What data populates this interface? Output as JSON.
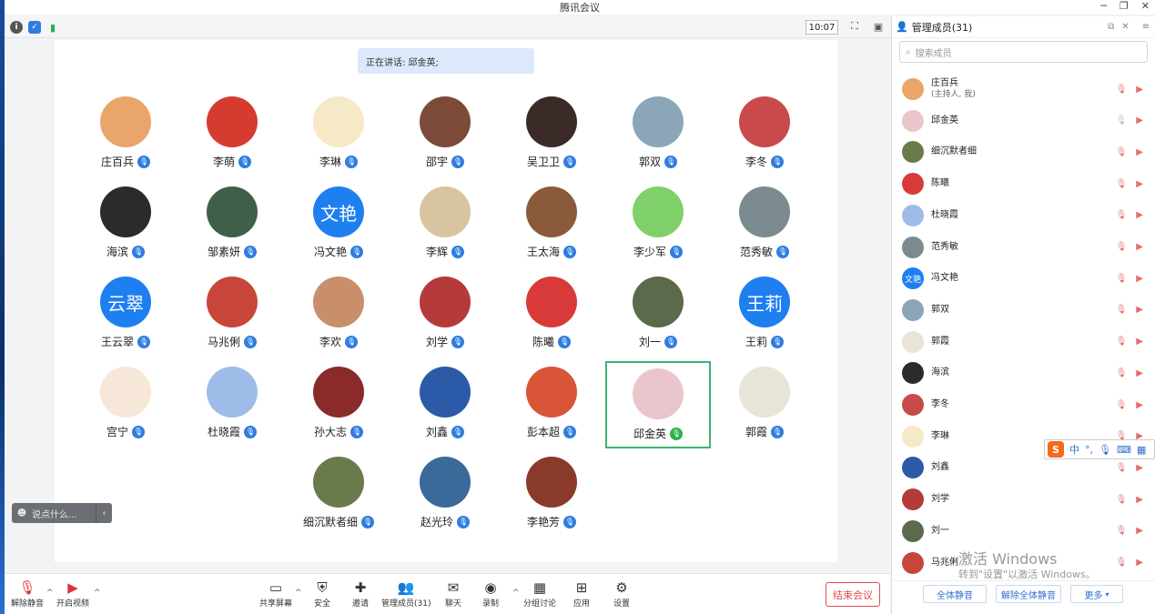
{
  "window": {
    "title": "腾讯会议",
    "time": "10:07"
  },
  "speaker": {
    "label": "正在讲话: 邱金英;"
  },
  "participants": [
    {
      "name": "庄百兵",
      "color": "#e9a56a",
      "kind": "img"
    },
    {
      "name": "李萌",
      "color": "#d63b2f",
      "kind": "img"
    },
    {
      "name": "李琳",
      "color": "#f5e9c8",
      "kind": "img"
    },
    {
      "name": "邵宇",
      "color": "#7d4a3a",
      "kind": "img"
    },
    {
      "name": "吴卫卫",
      "color": "#3a2a28",
      "kind": "img"
    },
    {
      "name": "郭双",
      "color": "#8aa6b8",
      "kind": "img"
    },
    {
      "name": "李冬",
      "color": "#c94a4a",
      "kind": "img"
    },
    {
      "name": "海滨",
      "color": "#2b2b2b",
      "kind": "img"
    },
    {
      "name": "邹素妍",
      "color": "#3f5f4a",
      "kind": "img"
    },
    {
      "name": "冯文艳",
      "color": "#1e7ff0",
      "kind": "text",
      "avatar_text": "文艳"
    },
    {
      "name": "李辉",
      "color": "#d9c4a0",
      "kind": "img"
    },
    {
      "name": "王太海",
      "color": "#8a5a3a",
      "kind": "img"
    },
    {
      "name": "李少军",
      "color": "#7fd06a",
      "kind": "img"
    },
    {
      "name": "范秀敏",
      "color": "#7a8a8f",
      "kind": "img"
    },
    {
      "name": "王云翠",
      "color": "#1e7ff0",
      "kind": "text",
      "avatar_text": "云翠"
    },
    {
      "name": "马兆俐",
      "color": "#c8453a",
      "kind": "img"
    },
    {
      "name": "李欢",
      "color": "#c98f6a",
      "kind": "img"
    },
    {
      "name": "刘学",
      "color": "#b53a3a",
      "kind": "img"
    },
    {
      "name": "陈曦",
      "color": "#d83a3a",
      "kind": "img"
    },
    {
      "name": "刘一",
      "color": "#5a6a4a",
      "kind": "img"
    },
    {
      "name": "王莉",
      "color": "#1e7ff0",
      "kind": "text",
      "avatar_text": "王莉"
    },
    {
      "name": "宫宁",
      "color": "#f6e7d8",
      "kind": "img"
    },
    {
      "name": "杜晓霞",
      "color": "#9fbbe8",
      "kind": "img"
    },
    {
      "name": "孙大志",
      "color": "#8a2a2a",
      "kind": "img"
    },
    {
      "name": "刘鑫",
      "color": "#2b5aa8",
      "kind": "img"
    },
    {
      "name": "彭本超",
      "color": "#d8553a",
      "kind": "img"
    },
    {
      "name": "邱金英",
      "color": "#e9c6cc",
      "kind": "img",
      "active": true
    },
    {
      "name": "郭霞",
      "color": "#e8e4d8",
      "kind": "img"
    },
    {
      "name": "细沉默者细",
      "color": "#6a7a4a",
      "kind": "img"
    },
    {
      "name": "赵光玲",
      "color": "#3a6a9a",
      "kind": "img"
    },
    {
      "name": "李艳芳",
      "color": "#8a3a2a",
      "kind": "img"
    }
  ],
  "chat": {
    "placeholder": "说点什么..."
  },
  "toolbar": {
    "unmute": "解除静音",
    "video": "开启视频",
    "share": "共享屏幕",
    "security": "安全",
    "invite": "邀请",
    "members": "管理成员(31)",
    "chat": "聊天",
    "record": "录制",
    "breakout": "分组讨论",
    "apps": "应用",
    "settings": "设置",
    "end": "结束会议"
  },
  "panel": {
    "title": "管理成员(31)",
    "search_placeholder": "搜索成员",
    "members": [
      {
        "name": "庄百兵",
        "sub": "(主持人, 我)",
        "color": "#e9a56a"
      },
      {
        "name": "邱金英",
        "sub": "",
        "color": "#e9c6cc",
        "speaking": true
      },
      {
        "name": "细沉默者细",
        "sub": "",
        "color": "#6a7a4a"
      },
      {
        "name": "陈曦",
        "sub": "",
        "color": "#d83a3a"
      },
      {
        "name": "杜晓霞",
        "sub": "",
        "color": "#9fbbe8"
      },
      {
        "name": "范秀敏",
        "sub": "",
        "color": "#7a8a8f"
      },
      {
        "name": "冯文艳",
        "sub": "",
        "color": "#1e7ff0",
        "avatar_text": "文艳"
      },
      {
        "name": "郭双",
        "sub": "",
        "color": "#8aa6b8"
      },
      {
        "name": "郭霞",
        "sub": "",
        "color": "#e8e4d8"
      },
      {
        "name": "海滨",
        "sub": "",
        "color": "#2b2b2b"
      },
      {
        "name": "李冬",
        "sub": "",
        "color": "#c94a4a"
      },
      {
        "name": "李琳",
        "sub": "",
        "color": "#f5e9c8"
      },
      {
        "name": "刘鑫",
        "sub": "",
        "color": "#2b5aa8"
      },
      {
        "name": "刘学",
        "sub": "",
        "color": "#b53a3a"
      },
      {
        "name": "刘一",
        "sub": "",
        "color": "#5a6a4a"
      },
      {
        "name": "马兆俐",
        "sub": "",
        "color": "#c8453a"
      }
    ],
    "mute_all": "全体静音",
    "unmute_all": "解除全体静音",
    "more": "更多"
  },
  "watermark": {
    "line1": "激活 Windows",
    "line2": "转到\"设置\"以激活 Windows。"
  },
  "ime": {
    "label": "中"
  }
}
